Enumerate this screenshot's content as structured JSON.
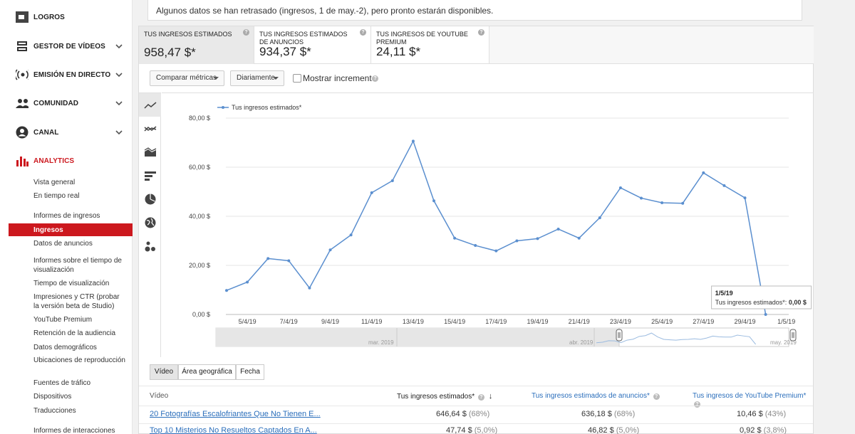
{
  "sidebar": {
    "logros": "LOGROS",
    "gestor": "GESTOR DE VÍDEOS",
    "emision": "EMISIÓN EN DIRECTO",
    "comunidad": "COMUNIDAD",
    "canal": "CANAL",
    "analytics": "ANALYTICS",
    "sub": [
      "Vista general",
      "En tiempo real",
      "Informes de ingresos",
      "Ingresos",
      "Datos de anuncios",
      "Informes sobre el tiempo de visualización",
      "Tiempo de visualización",
      "Impresiones y CTR (probar la versión beta de Studio)",
      "YouTube Premium",
      "Retención de la audiencia",
      "Datos demográficos",
      "Ubicaciones de reproducción",
      "Fuentes de tráfico",
      "Dispositivos",
      "Traducciones",
      "Informes de interacciones"
    ]
  },
  "banner": "Algunos datos se han retrasado (ingresos, 1 de may.-2), pero pronto estarán disponibles.",
  "metrics": [
    {
      "title": "TUS INGRESOS ESTIMADOS",
      "value": "958,47 $*"
    },
    {
      "title": "TUS INGRESOS ESTIMADOS DE ANUNCIOS",
      "value": "934,37 $*"
    },
    {
      "title": "TUS INGRESOS DE YOUTUBE PREMIUM",
      "value": "24,11 $*"
    }
  ],
  "controls": {
    "compare": "Comparar métricas",
    "interval": "Diariamente",
    "show_increment": "Mostrar incremento"
  },
  "colors": {
    "accent_red": "#cc181e",
    "line": "#5b8fcf",
    "link": "#2a6ebb"
  },
  "chart_data": {
    "type": "line",
    "legend": "Tus ingresos estimados*",
    "legend_position": "top-left",
    "grid": true,
    "ylim": [
      0,
      80
    ],
    "y_ticks": [
      "0,00 $",
      "20,00 $",
      "40,00 $",
      "60,00 $",
      "80,00 $"
    ],
    "x_tick_labels": [
      "5/4/19",
      "7/4/19",
      "9/4/19",
      "11/4/19",
      "13/4/19",
      "15/4/19",
      "17/4/19",
      "19/4/19",
      "21/4/19",
      "23/4/19",
      "25/4/19",
      "27/4/19",
      "29/4/19",
      "1/5/19"
    ],
    "x": [
      "4/4/19",
      "5/4/19",
      "6/4/19",
      "7/4/19",
      "8/4/19",
      "9/4/19",
      "10/4/19",
      "11/4/19",
      "12/4/19",
      "13/4/19",
      "14/4/19",
      "15/4/19",
      "16/4/19",
      "17/4/19",
      "18/4/19",
      "19/4/19",
      "20/4/19",
      "21/4/19",
      "22/4/19",
      "23/4/19",
      "24/4/19",
      "25/4/19",
      "26/4/19",
      "27/4/19",
      "28/4/19",
      "29/4/19",
      "30/4/19",
      "1/5/19"
    ],
    "series": [
      {
        "name": "Tus ingresos estimados*",
        "values": [
          9.8,
          13.2,
          22.8,
          21.9,
          10.8,
          26.3,
          32.4,
          49.6,
          54.5,
          70.6,
          46.3,
          31.1,
          28.1,
          25.9,
          30.0,
          30.9,
          34.8,
          31.1,
          39.4,
          51.6,
          47.4,
          45.5,
          45.3,
          57.7,
          52.5,
          47.5,
          0.0
        ]
      }
    ],
    "tooltip": {
      "date": "1/5/19",
      "label": "Tus ingresos estimados*:",
      "value": "0,00 $"
    },
    "navigator_labels": [
      "mar. 2019",
      "abr. 2019",
      "may. 2019"
    ]
  },
  "tabs": [
    "Vídeo",
    "Área geográfica",
    "Fecha"
  ],
  "table": {
    "headers": [
      "Vídeo",
      "Tus ingresos estimados*",
      "Tus ingresos estimados de anuncios*",
      "Tus ingresos de YouTube Premium*"
    ],
    "rows": [
      {
        "title": "20 Fotografías Escalofriantes Que No Tienen E...",
        "c1": "646,64 $",
        "p1": "(68%)",
        "c2": "636,18 $",
        "p2": "(68%)",
        "c3": "10,46 $",
        "p3": "(43%)"
      },
      {
        "title": "Top 10 Misterios No Resueltos Captados En A...",
        "c1": "47,74 $",
        "p1": "(5,0%)",
        "c2": "46,82 $",
        "p2": "(5,0%)",
        "c3": "0,92 $",
        "p3": "(3,8%)"
      }
    ]
  }
}
